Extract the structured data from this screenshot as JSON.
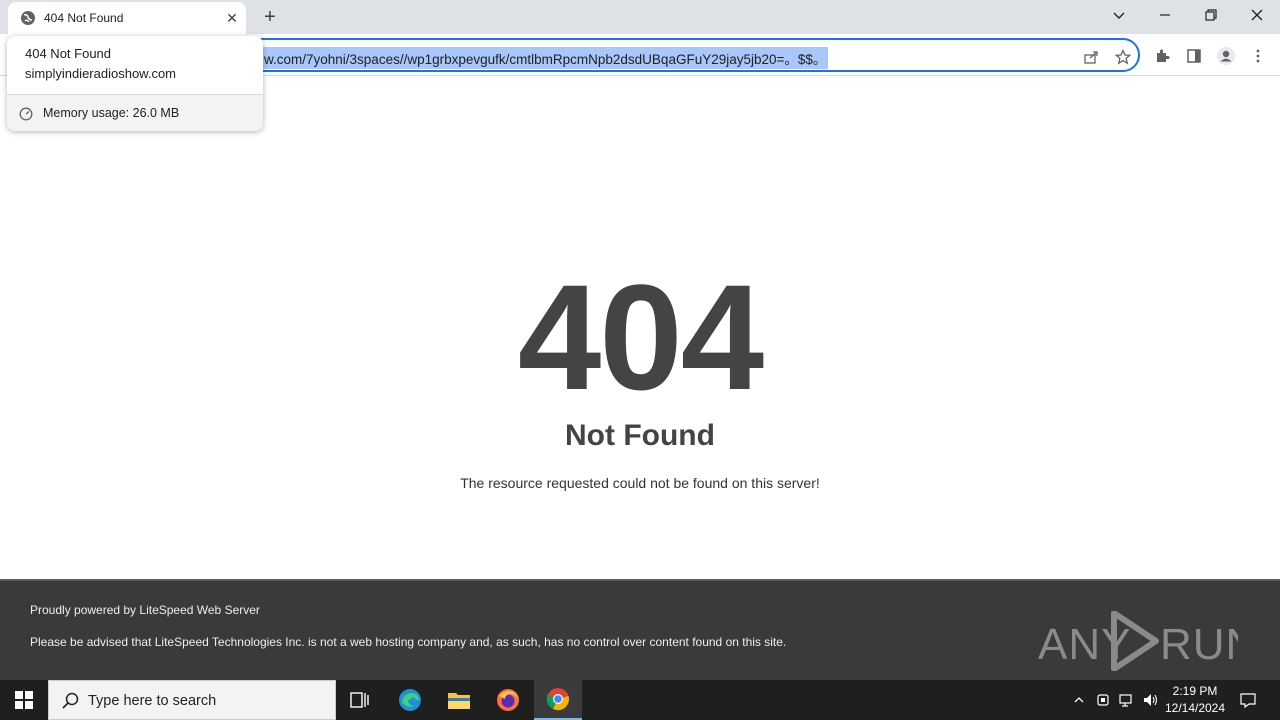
{
  "browser": {
    "tab_title": "404 Not Found",
    "tab_close": "✕",
    "new_tab": "+",
    "url": "w.com/7yohni/3spaces//wp1grbxpevgufk/cmtlbmRpcmNpb2dsdUBqaGFuY29jay5jb20=。$$。"
  },
  "hovercard": {
    "title": "404 Not Found",
    "domain": "simplyindieradioshow.com",
    "memory": "Memory usage: 26.0 MB"
  },
  "page": {
    "code": "404",
    "heading": "Not Found",
    "message": "The resource requested could not be found on this server!",
    "footer_powered": "Proudly powered by LiteSpeed Web Server",
    "footer_notice": "Please be advised that LiteSpeed Technologies Inc. is not a web hosting company and, as such, has no control over content found on this site."
  },
  "watermark": {
    "text": "ANY RUN"
  },
  "taskbar": {
    "search_placeholder": "Type here to search",
    "time": "2:19 PM",
    "date": "12/14/2024"
  },
  "colors": {
    "accent": "#1a73e8",
    "url_highlight": "#a8c7fa",
    "heading_gray": "#444444",
    "footer_bg": "#3a3a3a",
    "taskbar_bg": "#1f1f1f"
  },
  "icons": [
    "globe-icon",
    "close-icon",
    "plus-icon",
    "chevron-down-icon",
    "minimize-icon",
    "restore-icon",
    "window-close-icon",
    "share-icon",
    "star-icon",
    "extensions-icon",
    "side-panel-icon",
    "profile-icon",
    "menu-icon",
    "memory-icon",
    "windows-start-icon",
    "search-icon",
    "task-view-icon",
    "edge-icon",
    "file-explorer-icon",
    "firefox-icon",
    "chrome-icon",
    "tray-chevron-icon",
    "network-icon",
    "volume-icon",
    "notification-icon"
  ]
}
